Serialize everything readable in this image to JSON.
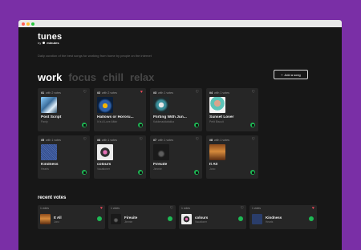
{
  "app": {
    "title": "tunes",
    "by": "by",
    "brand": "minutes",
    "tagline": "Daily curation of the best songs for working from home by people on the internet"
  },
  "tabs": [
    {
      "label": "work",
      "active": true
    },
    {
      "label": "focus",
      "active": false
    },
    {
      "label": "chill",
      "active": false
    },
    {
      "label": "relax",
      "active": false
    }
  ],
  "add_button": {
    "label": "Add a song",
    "icon": "plus-icon"
  },
  "songs": [
    {
      "rank": "#1",
      "votes": "with 2 votes",
      "liked": false,
      "title": "Post Script",
      "artist": "Panty",
      "art": "art-a"
    },
    {
      "rank": "#2",
      "votes": "with 2 votes",
      "liked": true,
      "title": "Hallows or Hororu...",
      "artist": "It Is A Love Affair",
      "art": "art-b"
    },
    {
      "rank": "#3",
      "votes": "with 1 votes",
      "liked": false,
      "title": "Flirting With Jun...",
      "artist": "Kakkmaddafakka",
      "art": "art-c"
    },
    {
      "rank": "#4",
      "votes": "with 1 votes",
      "liked": false,
      "title": "Sunset Lover",
      "artist": "Petit Biscuit",
      "art": "art-d"
    },
    {
      "rank": "#5",
      "votes": "with 1 votes",
      "liked": false,
      "title": "Kindness",
      "artist": "Hearts",
      "art": "art-e"
    },
    {
      "rank": "#6",
      "votes": "with 1 votes",
      "liked": false,
      "title": "colours",
      "artist": "Vacationer",
      "art": "art-f"
    },
    {
      "rank": "#7",
      "votes": "with 1 votes",
      "liked": false,
      "title": "Fireuite",
      "artist": "Jimmie",
      "art": "art-g"
    },
    {
      "rank": "#8",
      "votes": "with 1 votes",
      "liked": false,
      "title": "It All",
      "artist": "Jono",
      "art": "art-h"
    }
  ],
  "recent": {
    "title": "recent votes",
    "items": [
      {
        "votes": "1 votes",
        "liked": true,
        "title": "It All",
        "artist": "Jono",
        "art": "art-h"
      },
      {
        "votes": "1 votes",
        "liked": false,
        "title": "Fireuite",
        "artist": "Jimmie",
        "art": "art-g"
      },
      {
        "votes": "1 votes",
        "liked": false,
        "title": "colours",
        "artist": "Vacationer",
        "art": "art-f"
      },
      {
        "votes": "1 votes",
        "liked": true,
        "title": "Kindness",
        "artist": "Hearts",
        "art": "art-j"
      }
    ]
  },
  "colors": {
    "background": "#7a2fa6",
    "window": "#171717",
    "card": "#262626",
    "spotify": "#1db954",
    "heart": "#ff4d5e"
  }
}
